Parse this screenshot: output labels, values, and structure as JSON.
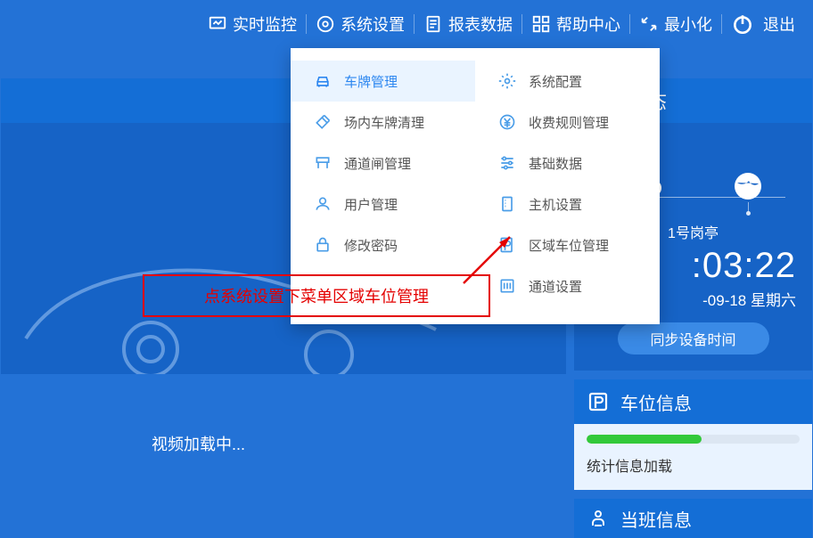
{
  "topnav": {
    "monitor": "实时监控",
    "settings": "系统设置",
    "report": "报表数据",
    "help": "帮助中心",
    "minimize": "最小化",
    "exit": "退出"
  },
  "dropdown": {
    "left": [
      {
        "label": "车牌管理"
      },
      {
        "label": "场内车牌清理"
      },
      {
        "label": "通道闸管理"
      },
      {
        "label": "用户管理"
      },
      {
        "label": "修改密码"
      }
    ],
    "right": [
      {
        "label": "系统配置"
      },
      {
        "label": "收费规则管理"
      },
      {
        "label": "基础数据"
      },
      {
        "label": "主机设置"
      },
      {
        "label": "区域车位管理"
      },
      {
        "label": "通道设置"
      }
    ]
  },
  "annotation": "点系统设置下菜单区域车位管理",
  "video_loading": "视频加载中...",
  "side": {
    "status_title": "服务状态",
    "station": "1号岗亭",
    "time": ":03:22",
    "date": "-09-18 星期六",
    "sync_btn": "同步设备时间",
    "parking_title": "车位信息",
    "parking_stat": "统计信息加载",
    "duty_title": "当班信息"
  }
}
